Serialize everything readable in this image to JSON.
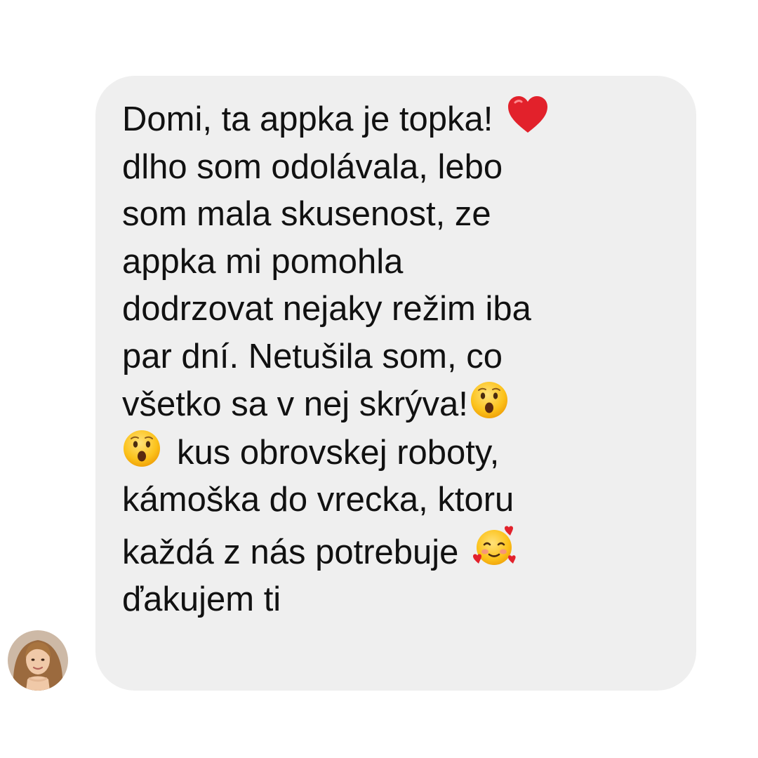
{
  "message": {
    "sender_avatar": "avatar",
    "lines": [
      "Domi, ta appka je topka!",
      "dlho som odolávala, lebo",
      "som mala skusenost, ze",
      "appka mi pomohla",
      "dodrzovat nejaky režim iba",
      "par dní. Netušila som, co",
      "všetko sa v nej skrýva!",
      "kus obrovskej roboty,",
      "kámoška do vrecka, ktoru",
      "každá z nás potrebuje",
      "ďakujem ti"
    ],
    "emojis": [
      "red-heart-icon",
      "hushed-face-icon",
      "hushed-face-icon",
      "smiling-face-with-hearts-icon"
    ]
  },
  "colors": {
    "bubble_background": "#efefef",
    "text": "#111111",
    "page_background": "#ffffff"
  }
}
